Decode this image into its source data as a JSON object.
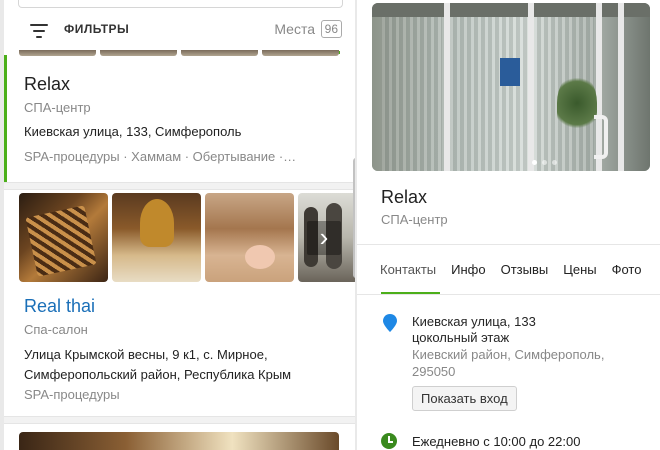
{
  "filters": {
    "label": "ФИЛЬТРЫ",
    "places_label": "Места",
    "places_count": "96"
  },
  "results": [
    {
      "title": "Relax",
      "type": "СПА-центр",
      "address": "Киевская улица, 133, Симферополь",
      "tags": "SPA-процедуры · Хаммам · Обертывание ·…"
    },
    {
      "title": "Real thai",
      "type": "Спа-салон",
      "address_line1": "Улица Крымской весны, 9 к1, с. Мирное,",
      "address_line2": "Симферопольский район, Республика Крым",
      "tags": "SPA-процедуры"
    }
  ],
  "detail": {
    "title": "Relax",
    "type": "СПА-центр",
    "tabs": [
      "Контакты",
      "Инфо",
      "Отзывы",
      "Цены",
      "Фото"
    ],
    "active_tab": "Контакты",
    "address_line1": "Киевская улица, 133",
    "address_line2": "цокольный этаж",
    "district_line1": "Киевский район, Симферополь,",
    "district_line2": "295050",
    "entrance_button": "Показать вход",
    "hours": "Ежедневно с 10:00 до 22:00"
  },
  "colors": {
    "accent_green": "#4caf1a",
    "link_blue": "#1a6fb8",
    "pin_blue": "#1e88e5"
  },
  "icons": {
    "filter": "filter-icon",
    "arrow": "chevron-right-icon",
    "pin": "location-pin-icon",
    "clock": "clock-icon"
  }
}
